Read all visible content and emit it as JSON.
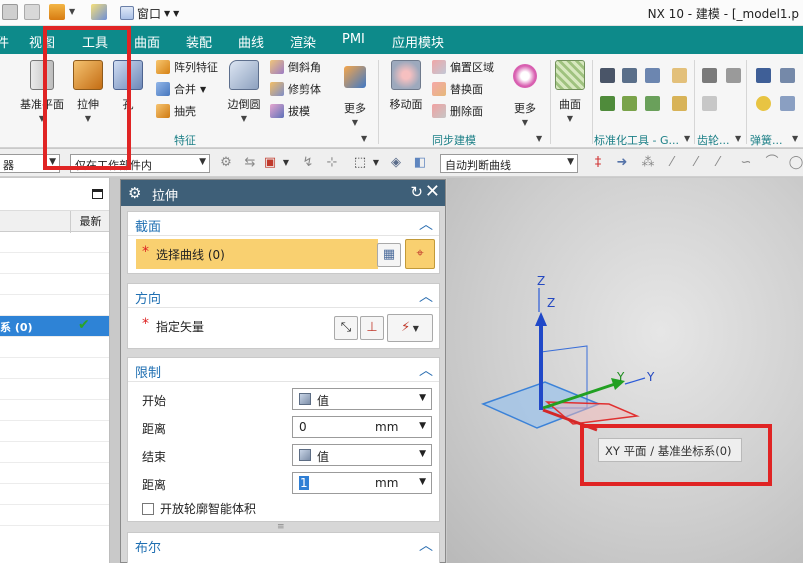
{
  "titlebar": {
    "window_menu": "窗口",
    "title": "NX 10 - 建模 - [_model1.p"
  },
  "menu": {
    "tabs": [
      "件",
      "视图",
      "工具",
      "曲面",
      "装配",
      "曲线",
      "渲染",
      "PMI",
      "应用模块"
    ]
  },
  "ribbon": {
    "datum_plane": "基准平面",
    "extrude": "拉伸",
    "hole": "孔",
    "pattern_feature": "阵列特征",
    "unite": "合并",
    "shell": "抽壳",
    "edge_blend": "边倒圆",
    "chamfer": "倒斜角",
    "trim_body": "修剪体",
    "draft": "拔模",
    "more1": "更多",
    "feature_group": "特征",
    "move_face": "移动面",
    "offset_region": "偏置区域",
    "replace_face": "替换面",
    "delete_face": "删除面",
    "sync_group": "同步建模",
    "more2": "更多",
    "surface": "曲面",
    "std_tools_group": "标准化工具 - G...",
    "gear_group": "齿轮...",
    "spring_group": "弹簧..."
  },
  "selection_bar": {
    "filter_value": "器",
    "scope_value": "仅在工作部件内",
    "curve_rule": "自动判断曲线"
  },
  "navigator": {
    "column_latest": "最新",
    "selected_row": "系 (0)"
  },
  "dialog": {
    "title": "拉伸",
    "section": {
      "title": "截面",
      "select_curve": "选择曲线 (0)"
    },
    "direction": {
      "title": "方向",
      "specify_vector": "指定矢量"
    },
    "limits": {
      "title": "限制",
      "start_label": "开始",
      "start_value": "值",
      "distance1_label": "距离",
      "distance1_value": "0",
      "distance1_unit": "mm",
      "end_label": "结束",
      "end_value": "值",
      "distance2_label": "距离",
      "distance2_value": "1",
      "distance2_unit": "mm",
      "open_profile": "开放轮廓智能体积"
    },
    "boolean": {
      "title": "布尔"
    }
  },
  "viewport": {
    "axis_z_upper": "Z",
    "axis_z_lower": "Z",
    "axis_y_green": "Y",
    "axis_y_blue": "Y",
    "tooltip": "XY 平面 / 基准坐标系(0)"
  },
  "colors": {
    "menubar": "#0d8a8a",
    "dialog_title": "#3e5f78",
    "section_title": "#1f6fb2",
    "highlight": "#f9d070",
    "annotation": "#e02424"
  }
}
